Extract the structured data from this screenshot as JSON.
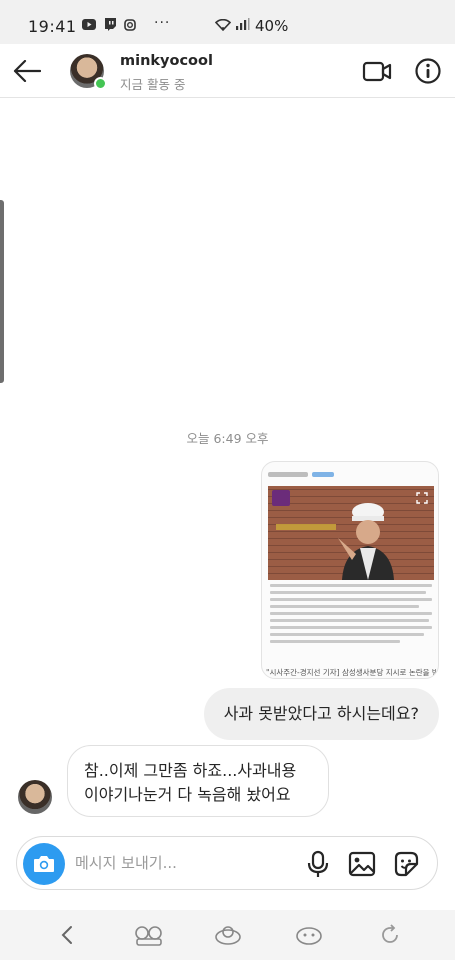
{
  "status_bar": {
    "time": "19:41",
    "battery": "40%",
    "more": "···"
  },
  "header": {
    "username": "minkyocool",
    "activity": "지금 활동 중"
  },
  "conversation": {
    "timestamp": "오늘 6:49 오후",
    "shared_image": {
      "caption": "\"시사주간-경지선 기자] 삼성생사분당 지시로 논란을 받\""
    },
    "outgoing_message": "사과 못받았다고 하시는데요?",
    "incoming_message": {
      "line1": "참..이제 그만좀 하죠...사과내용",
      "line2": "이야기나눈거 다 녹음해 놨어요"
    }
  },
  "composer": {
    "placeholder": "메시지 보내기..."
  },
  "colors": {
    "online": "#44c554",
    "camera_button": "#2d9bf0",
    "outgoing_bubble": "#efefef"
  }
}
